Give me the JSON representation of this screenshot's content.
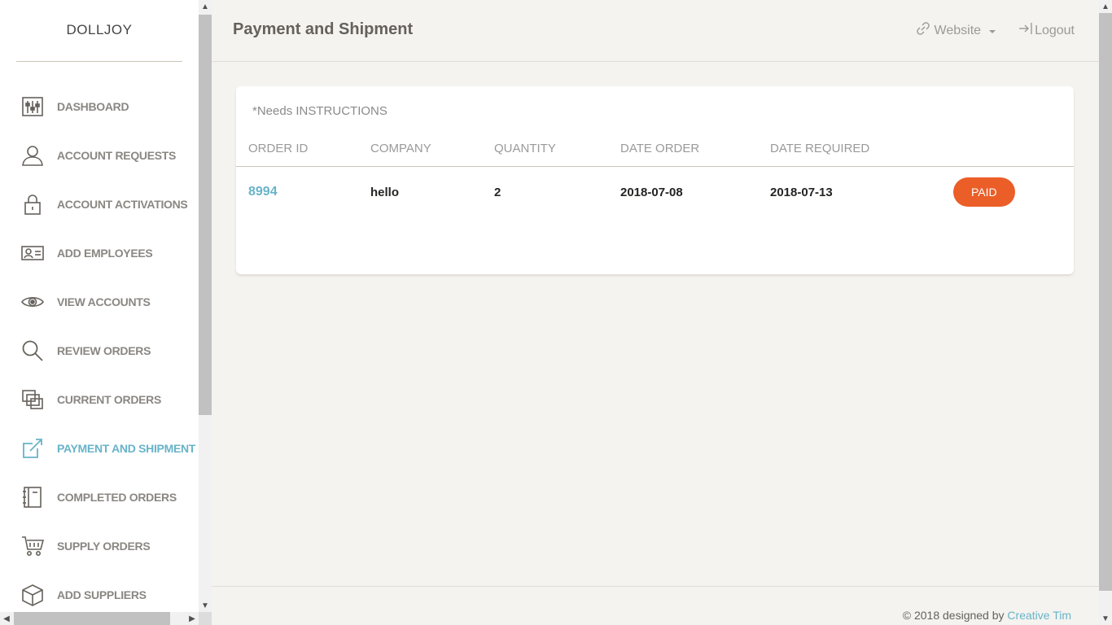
{
  "brand": "DOLLJOY",
  "sidebar": {
    "items": [
      {
        "label": "DASHBOARD",
        "icon": "equalizer-icon"
      },
      {
        "label": "ACCOUNT REQUESTS",
        "icon": "user-icon"
      },
      {
        "label": "ACCOUNT ACTIVATIONS",
        "icon": "lock-icon"
      },
      {
        "label": "ADD EMPLOYEES",
        "icon": "id-card-icon"
      },
      {
        "label": "VIEW ACCOUNTS",
        "icon": "eye-icon"
      },
      {
        "label": "REVIEW ORDERS",
        "icon": "search-icon"
      },
      {
        "label": "CURRENT ORDERS",
        "icon": "layers-icon"
      },
      {
        "label": "PAYMENT AND SHIPMENT",
        "icon": "share-icon",
        "active": true
      },
      {
        "label": "COMPLETED ORDERS",
        "icon": "notebook-icon"
      },
      {
        "label": "SUPPLY ORDERS",
        "icon": "cart-icon"
      },
      {
        "label": "ADD SUPPLIERS",
        "icon": "package-icon"
      }
    ]
  },
  "header": {
    "title": "Payment and Shipment",
    "website_label": "Website",
    "logout_label": "Logout"
  },
  "card": {
    "note": "*Needs INSTRUCTIONS",
    "columns": [
      "ORDER ID",
      "COMPANY",
      "QUANTITY",
      "DATE ORDER",
      "DATE REQUIRED"
    ],
    "rows": [
      {
        "order_id": "8994",
        "company": "hello",
        "quantity": "2",
        "date_order": "2018-07-08",
        "date_required": "2018-07-13",
        "status": "PAID"
      }
    ]
  },
  "footer": {
    "text": "© 2018 designed by",
    "link": "Creative Tim"
  },
  "colors": {
    "accent": "#68b3c8",
    "status_paid": "#eb5e28",
    "background": "#f4f3ef"
  }
}
